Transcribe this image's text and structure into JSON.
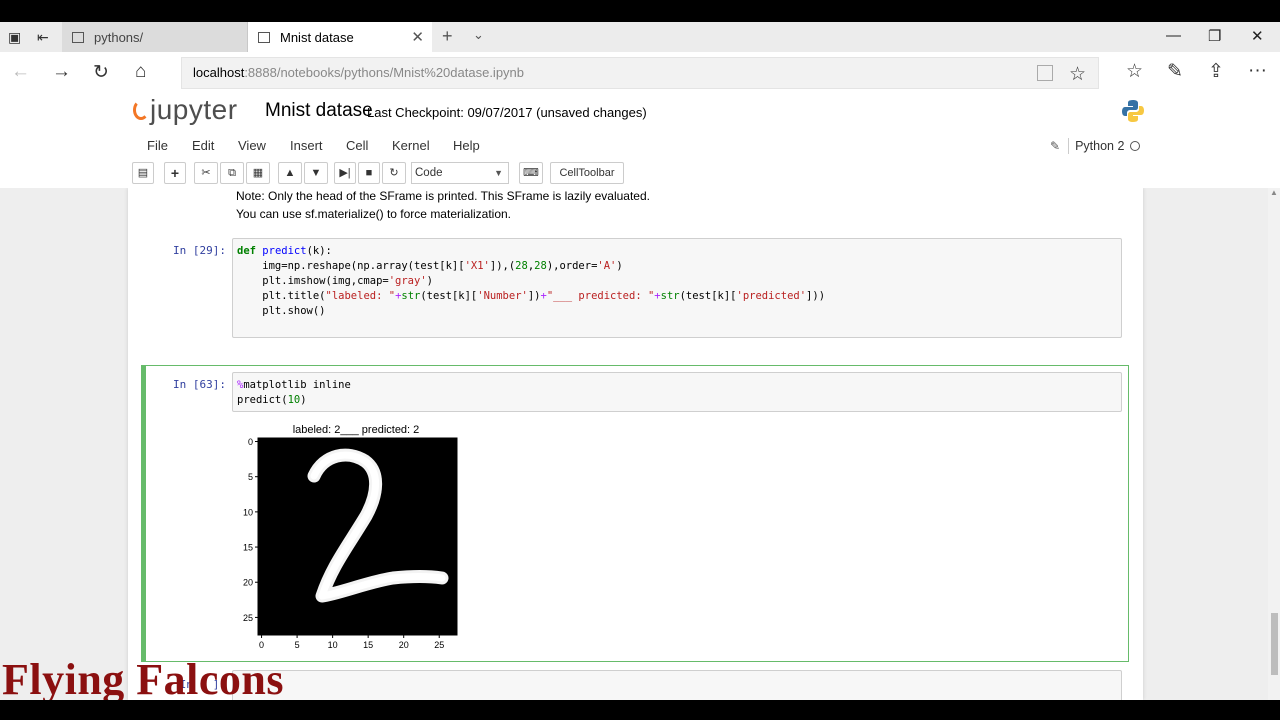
{
  "browser": {
    "tabs": [
      {
        "label": "pythons/",
        "active": false
      },
      {
        "label": "Mnist datase",
        "active": true
      }
    ],
    "url_host": "localhost",
    "url_rest": ":8888/notebooks/pythons/Mnist%20datase.ipynb"
  },
  "jupyter": {
    "logo": "jupyter",
    "notebook_name": "Mnist datase",
    "checkpoint": "Last Checkpoint: 09/07/2017 (unsaved changes)",
    "kernel": "Python 2"
  },
  "menu": [
    "File",
    "Edit",
    "View",
    "Insert",
    "Cell",
    "Kernel",
    "Help"
  ],
  "toolbar": {
    "cell_type": "Code",
    "celltoolbar_label": "CellToolbar"
  },
  "cells": {
    "output_note_1": "Note: Only the head of the SFrame is printed. This SFrame is lazily evaluated.",
    "output_note_2": "You can use sf.materialize() to force materialization.",
    "cell29_prompt": "In [29]:",
    "cell63_prompt": "In [63]:",
    "cell_empty_prompt": "In [ ]:"
  },
  "chart_data": {
    "type": "image",
    "title": "labeled: 2___ predicted: 2",
    "image_content": "handwritten digit 2, white on black",
    "y_ticks": [
      "0",
      "5",
      "10",
      "15",
      "20",
      "25"
    ],
    "x_ticks": [
      "0",
      "5",
      "10",
      "15",
      "20",
      "25"
    ],
    "xlim": [
      0,
      28
    ],
    "ylim": [
      0,
      28
    ]
  },
  "watermark": "Flying Falcons",
  "colors": {
    "selected_cell_border": "#66bb6a",
    "prompt_color": "#303f9f",
    "watermark": "#8b1010",
    "jupyter_orange": "#f37726"
  }
}
